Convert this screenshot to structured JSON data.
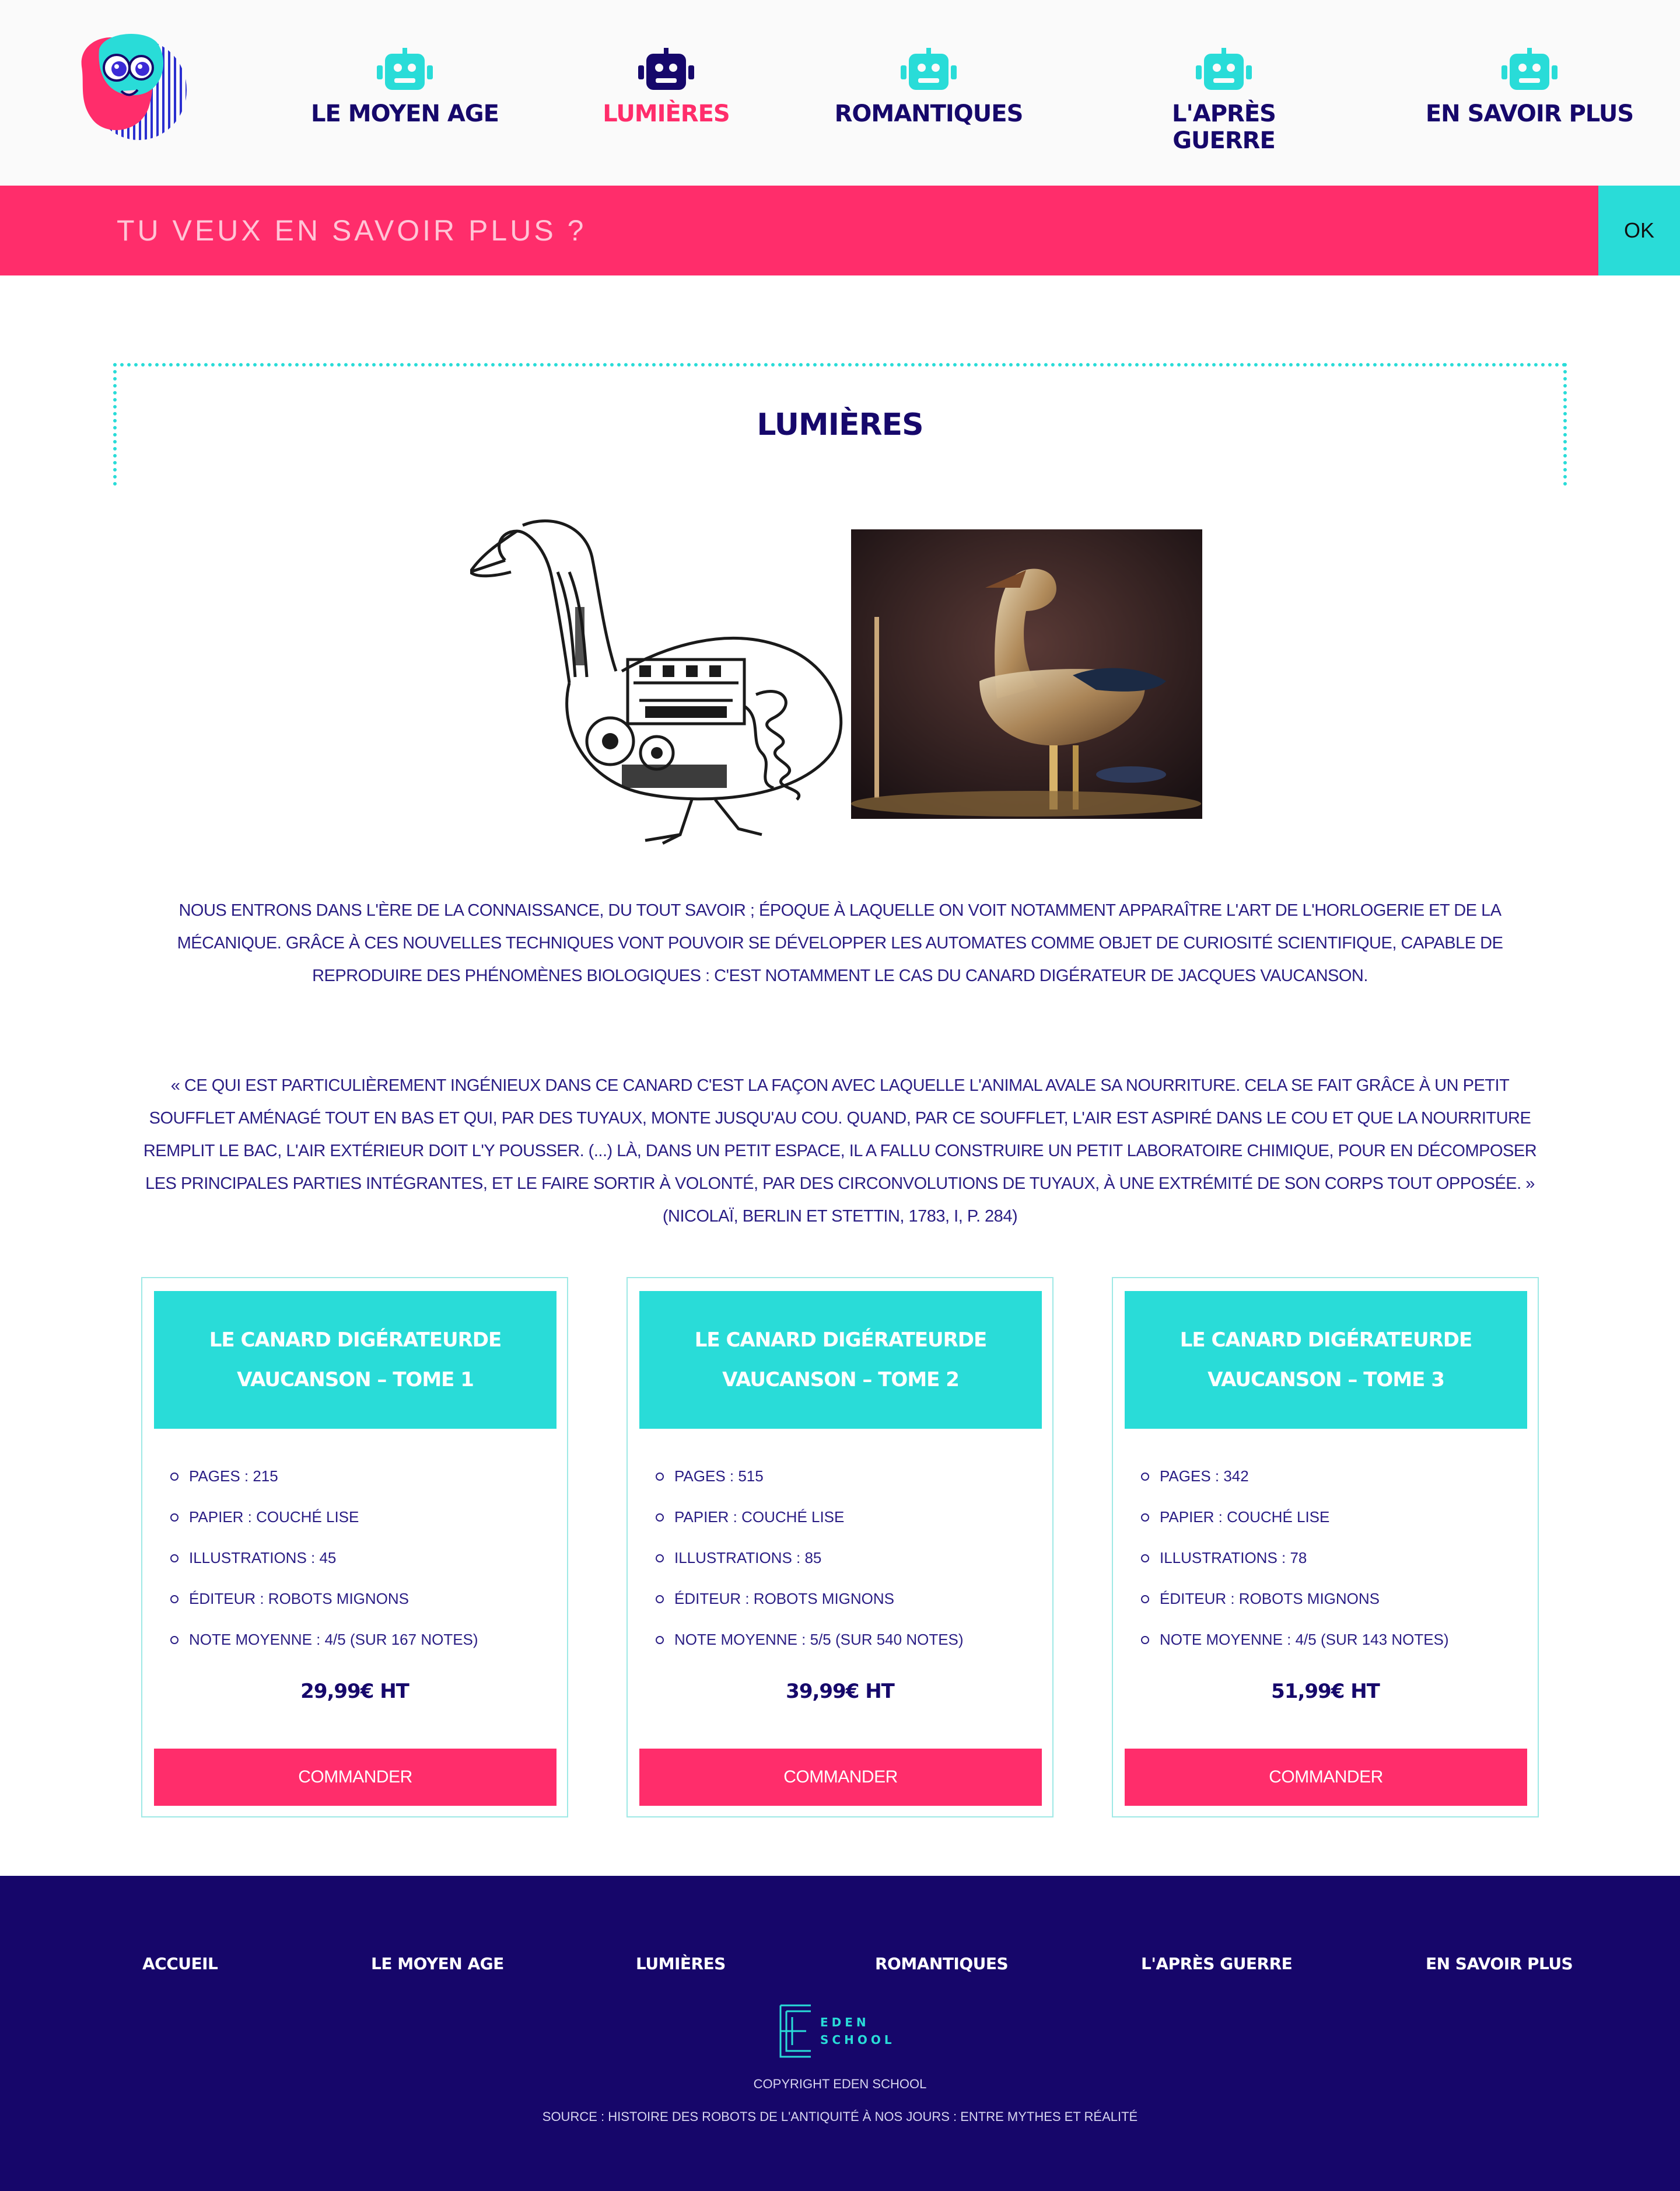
{
  "nav": {
    "items": [
      {
        "label": "LE MOYEN AGE",
        "active": false
      },
      {
        "label": "LUMIÈRES",
        "active": true
      },
      {
        "label": "ROMANTIQUES",
        "active": false
      },
      {
        "label": "L'APRÈS GUERRE",
        "active": false
      },
      {
        "label": "EN SAVOIR PLUS",
        "active": false
      }
    ],
    "robot_icon": "robot-icon",
    "active_color": "#ff2d6b",
    "inactive_icon_color": "#29dcd8",
    "active_icon_color": "#16086b"
  },
  "newsletter": {
    "placeholder": "TU VEUX EN SAVOIR PLUS ?",
    "button_label": "OK"
  },
  "page": {
    "title": "LUMIÈRES",
    "intro": "NOUS ENTRONS DANS L'ÈRE DE LA CONNAISSANCE, DU TOUT SAVOIR ; ÉPOQUE À LAQUELLE ON VOIT NOTAMMENT APPARAÎTRE L'ART DE L'HORLOGERIE ET DE LA MÉCANIQUE. GRÂCE À CES NOUVELLES TECHNIQUES VONT POUVOIR SE DÉVELOPPER LES AUTOMATES COMME OBJET DE CURIOSITÉ SCIENTIFIQUE, CAPABLE DE REPRODUIRE DES PHÉNOMÈNES BIOLOGIQUES : C'EST NOTAMMENT LE CAS DU CANARD DIGÉRATEUR DE JACQUES VAUCANSON.",
    "quote": "« CE QUI EST PARTICULIÈREMENT INGÉNIEUX DANS CE CANARD C'EST LA FAÇON AVEC LAQUELLE L'ANIMAL AVALE SA NOURRITURE. CELA SE FAIT GRÂCE À UN PETIT SOUFFLET AMÉNAGÉ TOUT EN BAS ET QUI, PAR DES TUYAUX, MONTE JUSQU'AU COU. QUAND, PAR CE SOUFFLET, L'AIR EST ASPIRÉ DANS LE COU ET QUE LA NOURRITURE REMPLIT LE BAC, L'AIR EXTÉRIEUR DOIT L'Y POUSSER. (...) LÀ, DANS UN PETIT ESPACE, IL A FALLU CONSTRUIRE UN PETIT LABORATOIRE CHIMIQUE, POUR EN DÉCOMPOSER LES PRINCIPALES PARTIES INTÉGRANTES, ET LE FAIRE SORTIR À VOLONTÉ, PAR DES CIRCONVOLUTIONS DE TUYAUX, À UNE EXTRÉMITÉ DE SON CORPS TOUT OPPOSÉE. » (NICOLAÏ, BERLIN ET STETTIN, 1783, I, P. 284)"
  },
  "products": [
    {
      "title": "LE CANARD DIGÉRATEURDE VAUCANSON – TOME 1",
      "specs": [
        "PAGES : 215",
        "PAPIER : COUCHÉ LISE",
        "ILLUSTRATIONS : 45",
        "ÉDITEUR : ROBOTS MIGNONS",
        "NOTE MOYENNE : 4/5 (SUR 167 NOTES)"
      ],
      "price": "29,99€ HT",
      "button_label": "COMMANDER"
    },
    {
      "title": "LE CANARD DIGÉRATEURDE VAUCANSON – TOME 2",
      "specs": [
        "PAGES : 515",
        "PAPIER : COUCHÉ LISE",
        "ILLUSTRATIONS : 85",
        "ÉDITEUR : ROBOTS MIGNONS",
        "NOTE MOYENNE : 5/5 (SUR 540 NOTES)"
      ],
      "price": "39,99€ HT",
      "button_label": "COMMANDER"
    },
    {
      "title": "LE CANARD DIGÉRATEURDE VAUCANSON – TOME 3",
      "specs": [
        "PAGES : 342",
        "PAPIER : COUCHÉ LISE",
        "ILLUSTRATIONS : 78",
        "ÉDITEUR : ROBOTS MIGNONS",
        "NOTE MOYENNE : 4/5 (SUR 143 NOTES)"
      ],
      "price": "51,99€ HT",
      "button_label": "COMMANDER"
    }
  ],
  "footer": {
    "links": [
      "ACCUEIL",
      "LE MOYEN AGE",
      "LUMIÈRES",
      "ROMANTIQUES",
      "L'APRÈS GUERRE",
      "EN SAVOIR PLUS"
    ],
    "brand_line1": "EDEN",
    "brand_line2": "SCHOOL",
    "copyright": "COPYRIGHT EDEN SCHOOL",
    "source": "SOURCE : HISTOIRE DES ROBOTS DE L'ANTIQUITÉ À NOS JOURS : ENTRE MYTHES ET RÉALITÉ"
  },
  "colors": {
    "navy": "#16086b",
    "pink": "#ff2d6b",
    "turquoise": "#29dcd8",
    "footer_bg": "#16066a"
  }
}
